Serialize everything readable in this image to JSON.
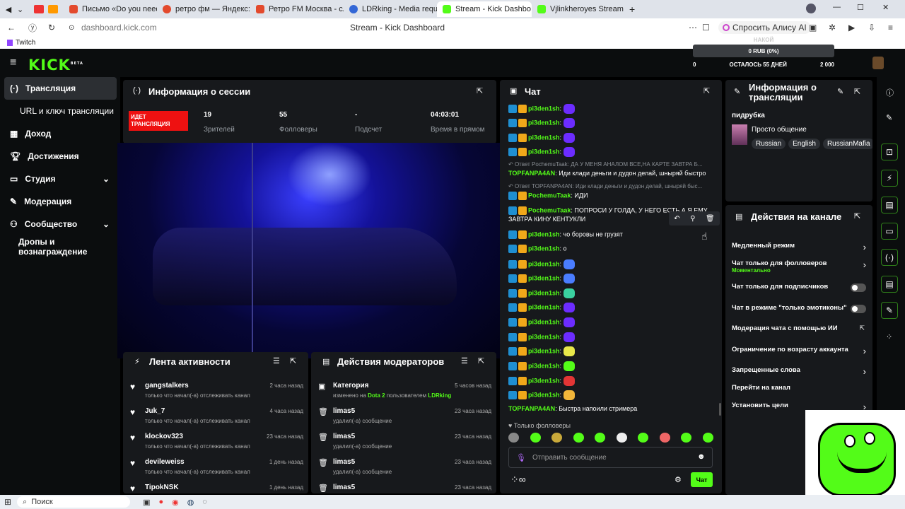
{
  "browser": {
    "tabs": [
      {
        "label": "Письмо «Do you need to m",
        "color": "#e34a2d"
      },
      {
        "label": "ретро фм — Яндекс: наш",
        "color": "#e34a2d"
      },
      {
        "label": "Ретро FM Москва - слуша",
        "color": "#e34a2d"
      },
      {
        "label": "LDRking - Media requ",
        "color": "#3367d6"
      },
      {
        "label": "Stream - Kick Dashbo",
        "color": "#53fc18"
      },
      {
        "label": "Vjlinkheroyes Stream - Wa",
        "color": "#53fc18"
      }
    ],
    "url": "dashboard.kick.com",
    "page_title": "Stream - Kick Dashboard",
    "alice_label": "Спросить Алису AI",
    "bookmark": "Twitch"
  },
  "kick": {
    "logo": "KICK",
    "logo_sup": "BETA",
    "goal": {
      "label": "НАКОЙ",
      "amount": "0 RUB (0%)",
      "left": "0",
      "middle": "ОСТАЛОСЬ 55 ДНЕЙ",
      "right": "2 000"
    }
  },
  "sidebar": {
    "items": [
      {
        "label": "Трансляция",
        "icon": "broadcast-icon"
      },
      {
        "label": "URL и ключ трансляции",
        "icon": ""
      },
      {
        "label": "Доход",
        "icon": "revenue-icon"
      },
      {
        "label": "Достижения",
        "icon": "trophy-icon"
      },
      {
        "label": "Студия",
        "icon": "studio-icon"
      },
      {
        "label": "Модерация",
        "icon": "wrench-icon"
      },
      {
        "label": "Сообщество",
        "icon": "community-icon"
      },
      {
        "label": "Дропы и вознаграждение",
        "icon": ""
      }
    ]
  },
  "session": {
    "title": "Информация о сессии",
    "live_badge": "ИДЕТ ТРАНСЛЯЦИЯ",
    "stats": [
      {
        "value": "19",
        "label": "Зрителей"
      },
      {
        "value": "55",
        "label": "Фолловеры"
      },
      {
        "value": "-",
        "label": "Подсчет"
      },
      {
        "value": "04:03:01",
        "label": "Время в прямом"
      }
    ]
  },
  "activity": {
    "title": "Лента активности",
    "items": [
      {
        "name": "gangstalkers",
        "text": "только что начал(-а) отслеживать канал",
        "time": "2 часа назад"
      },
      {
        "name": "Juk_7",
        "text": "только что начал(-а) отслеживать канал",
        "time": "4 часа назад"
      },
      {
        "name": "klockov323",
        "text": "только что начал(-а) отслеживать канал",
        "time": "23 часа назад"
      },
      {
        "name": "devileweiss",
        "text": "только что начал(-а) отслеживать канал",
        "time": "1 день назад"
      },
      {
        "name": "TipokNSK",
        "text": "",
        "time": "1 день назад"
      }
    ]
  },
  "modactions": {
    "title": "Действия модераторов",
    "items": [
      {
        "name": "Категория",
        "text_pre": "изменено на ",
        "highlight": "Dota 2",
        "text_mid": " пользователем ",
        "user": "LDRking",
        "time": "5 часов назад"
      },
      {
        "name": "limas5",
        "text": "удалил(-а) сообщение",
        "time": "23 часа назад"
      },
      {
        "name": "limas5",
        "text": "удалил(-а) сообщение",
        "time": "23 часа назад"
      },
      {
        "name": "limas5",
        "text": "удалил(-а) сообщение",
        "time": "23 часа назад"
      },
      {
        "name": "limas5",
        "text": "",
        "time": "23 часа назад"
      }
    ]
  },
  "chat": {
    "title": "Чат",
    "lines": [
      {
        "user": "pi3den1sh",
        "color": "#53fc18",
        "text": "",
        "emote": "#6c2cff"
      },
      {
        "user": "pi3den1sh",
        "color": "#53fc18",
        "text": "",
        "emote": "#6c2cff"
      },
      {
        "user": "pi3den1sh",
        "color": "#53fc18",
        "text": "",
        "emote": "#6c2cff"
      },
      {
        "user": "pi3den1sh",
        "color": "#53fc18",
        "text": "",
        "emote": "#6c2cff"
      },
      {
        "reply": "Ответ PochemuTaak: ДА У МЕНЯ АНАЛОМ ВСЕ,НА КАРТЕ ЗАВТРА Б..."
      },
      {
        "user": "TOPFANPA4AN",
        "color": "#53fc18",
        "text": "Иди клади деньги и дудон делай, шныряй быстро",
        "nobadge": true
      },
      {
        "reply": "Ответ TOPFANPA4AN: Иди клади деньги и дудон делай, шныряй быс..."
      },
      {
        "user": "PochemuTaak",
        "color": "#53fc18",
        "text": "ИДИ"
      },
      {
        "user": "PochemuTaak",
        "color": "#53fc18",
        "text": "ПОПРОСИ У ГОЛДА, У НЕГО ЕСТЬ А Я ЕМУ"
      },
      {
        "cont": "ЗАВТРА КИНУ КЕНТУКЛИ"
      },
      {
        "user": "pi3den1sh",
        "color": "#53fc18",
        "text": "чо боровы не грузят"
      },
      {
        "user": "pi3den1sh",
        "color": "#53fc18",
        "text": "о"
      },
      {
        "user": "pi3den1sh",
        "color": "#53fc18",
        "text": "",
        "emote": "#4a7dff"
      },
      {
        "user": "pi3den1sh",
        "color": "#53fc18",
        "text": "",
        "emote": "#4a7dff"
      },
      {
        "user": "pi3den1sh",
        "color": "#53fc18",
        "text": "",
        "emote": "#3ad1a0"
      },
      {
        "user": "pi3den1sh",
        "color": "#53fc18",
        "text": "",
        "emote": "#6c2cff"
      },
      {
        "user": "pi3den1sh",
        "color": "#53fc18",
        "text": "",
        "emote": "#6c2cff"
      },
      {
        "user": "pi3den1sh",
        "color": "#53fc18",
        "text": "",
        "emote": "#6c2cff"
      },
      {
        "user": "pi3den1sh",
        "color": "#53fc18",
        "text": "",
        "emote": "#e8e84a"
      },
      {
        "user": "pi3den1sh",
        "color": "#53fc18",
        "text": "",
        "emote": "#53fc18"
      },
      {
        "user": "pi3den1sh",
        "color": "#53fc18",
        "text": "",
        "emote": "#e23535"
      },
      {
        "user": "pi3den1sh",
        "color": "#53fc18",
        "text": "",
        "emote": "#f2b63a"
      },
      {
        "user": "TOPFANPA4AN",
        "color": "#53fc18",
        "text": "Быстра напоили стримера",
        "nobadge": true
      }
    ],
    "followers_only": "Только фолловеры",
    "input_placeholder": "Отправить сообщение",
    "send_label": "Чат"
  },
  "stream_info": {
    "title": "Информация о трансляции",
    "stream_title": "пидрубка",
    "category": "Просто общение",
    "tags": [
      "Russian",
      "English",
      "RussianMafia"
    ]
  },
  "channel_actions": {
    "title": "Действия на канале",
    "items": [
      {
        "label": "Медленный режим",
        "sub": "",
        "control": "chevron"
      },
      {
        "label": "Чат только для фолловеров",
        "sub": "Моментально",
        "control": "chevron"
      },
      {
        "label": "Чат только для подписчиков",
        "sub": "",
        "control": "toggle"
      },
      {
        "label": "Чат в режиме \"только эмотиконы\"",
        "sub": "",
        "control": "toggle"
      },
      {
        "label": "Модерация чата с помощью ИИ",
        "sub": "",
        "control": "external"
      },
      {
        "label": "Ограничение по возрасту аккаунта",
        "sub": "",
        "control": "chevron"
      },
      {
        "label": "Запрещенные слова",
        "sub": "",
        "control": "chevron"
      },
      {
        "label": "Перейти на канал",
        "sub": "",
        "control": "none"
      },
      {
        "label": "Установить цели",
        "sub": "",
        "control": "chevron"
      }
    ]
  },
  "taskbar": {
    "search": "Поиск"
  }
}
